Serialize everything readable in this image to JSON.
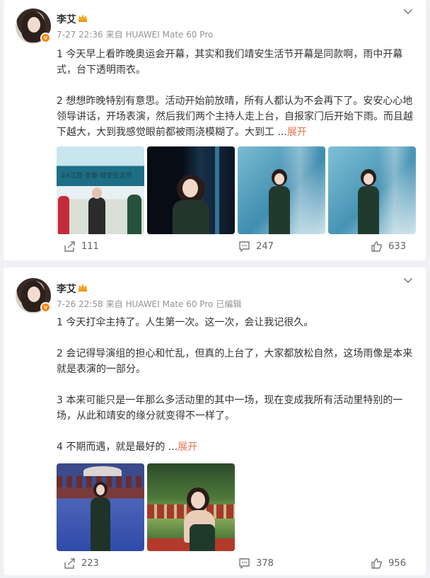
{
  "posts": [
    {
      "author": "李艾",
      "time": "7-27 22:36",
      "source": "来自 HUAWEI Mate 60 Pro",
      "edited": "",
      "paragraphs": [
        "1 今天早上看昨晚奥运会开幕，其实和我们靖安生活节开幕是同款啊，雨中开幕式，台下透明雨衣。",
        "2 想想昨晚特别有意思。活动开始前放晴，所有人都认为不会再下了。安安心心地领导讲话，开场表演，然后我们两个主持人走上台，自报家门后开始下雨。而且越下越大，大到我感觉眼前都被雨浇模糊了。大到工 ..."
      ],
      "expand": "展开",
      "images": [
        "event-stage-photo",
        "host-on-stage-photo",
        "host-rain-photo-1",
        "host-rain-photo-2"
      ],
      "banner_text": "24江西·宜春·靖安生活节",
      "repost": "111",
      "comment": "247",
      "like": "633"
    },
    {
      "author": "李艾",
      "time": "7-26 22:58",
      "source": "来自 HUAWEI Mate 60 Pro",
      "edited": "已编辑",
      "paragraphs": [
        "1 今天打伞主持了。人生第一次。这一次，会让我记很久。",
        "2 会记得导演组的担心和忙乱，但真的上台了，大家都放松自然，这场雨像是本来就是表演的一部分。",
        "3 本来可能只是一年那么多活动里的其中一场，现在变成我所有活动里特别的一场，从此和靖安的缘分就变得不一样了。",
        "4 不期而遇，就是最好的 ..."
      ],
      "expand": "展开",
      "images": [
        "host-umbrella-photo",
        "host-garden-photo"
      ],
      "repost": "223",
      "comment": "378",
      "like": "956"
    }
  ],
  "colors": {
    "background": "#eff1f4",
    "card": "#ffffff",
    "expand": "#eb7350",
    "meta": "#939393",
    "verified": "#ff8200"
  }
}
